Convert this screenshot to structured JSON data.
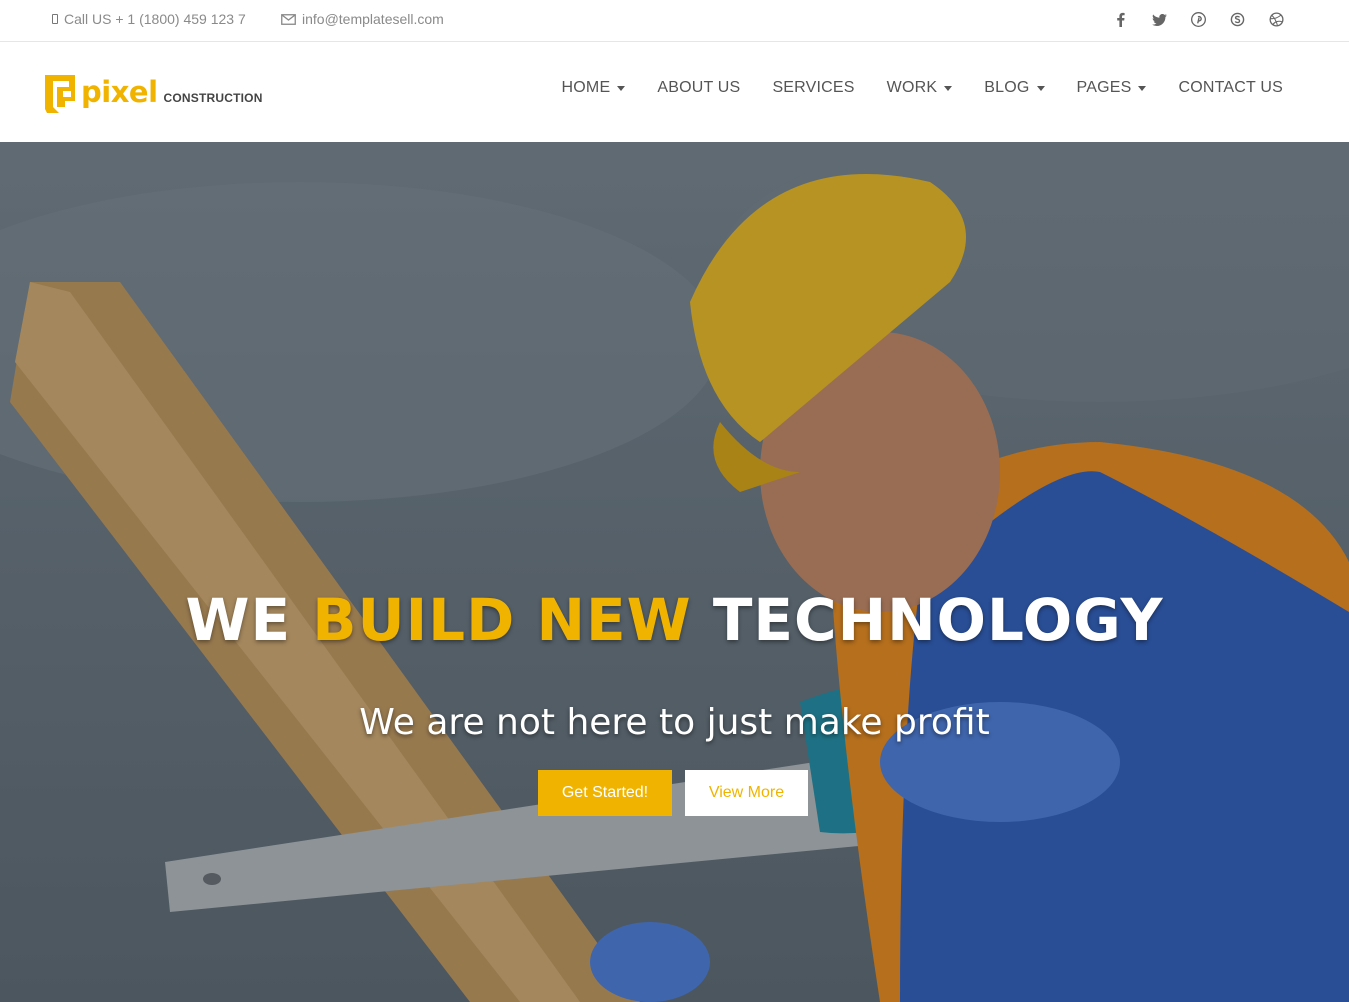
{
  "topbar": {
    "phone": "Call US + 1 (1800) 459 123 7",
    "email": "info@templatesell.com",
    "socials": [
      "facebook-icon",
      "twitter-icon",
      "pinterest-icon",
      "skype-icon",
      "dribbble-icon"
    ]
  },
  "brand": {
    "name": "pixel",
    "tagline": "CONSTRUCTION",
    "color": "#f0b400"
  },
  "nav": {
    "items": [
      {
        "label": "HOME",
        "dropdown": true
      },
      {
        "label": "ABOUT US",
        "dropdown": false
      },
      {
        "label": "SERVICES",
        "dropdown": false
      },
      {
        "label": "WORK",
        "dropdown": true
      },
      {
        "label": "BLOG",
        "dropdown": true
      },
      {
        "label": "PAGES",
        "dropdown": true
      },
      {
        "label": "CONTACT US",
        "dropdown": false
      }
    ]
  },
  "hero": {
    "title_part1": "WE ",
    "title_highlight": "BUILD NEW",
    "title_part2": " TECHNOLOGY",
    "subtitle": "We are not here to just make profit",
    "primary_button": "Get Started!",
    "secondary_button": "View More"
  }
}
